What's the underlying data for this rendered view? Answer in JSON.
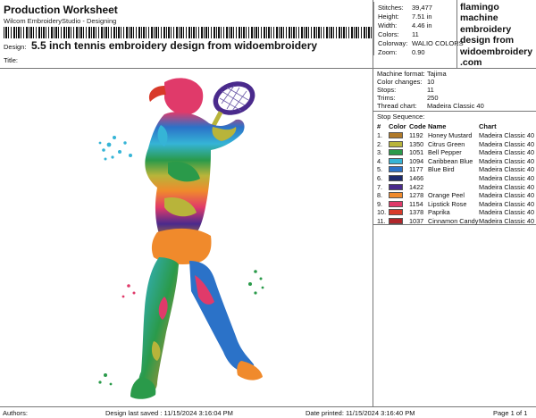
{
  "header": {
    "title": "Production Worksheet",
    "subtitle": "Wilcom EmbroideryStudio - Designing",
    "design_label": "Design:",
    "design_name": "5.5 inch tennis embroidery design from widoembroidery",
    "title_label": "Title:"
  },
  "stats": [
    {
      "label": "Stitches:",
      "value": "39,477"
    },
    {
      "label": "Height:",
      "value": "7.51 in"
    },
    {
      "label": "Width:",
      "value": "4.46 in"
    },
    {
      "label": "Colors:",
      "value": "11"
    },
    {
      "label": "Colorway:",
      "value": "WALIO COLORS"
    },
    {
      "label": "Zoom:",
      "value": "0.90"
    }
  ],
  "brand": {
    "lines": [
      "flamingo",
      "machine",
      "embroidery",
      "design from",
      "widoembroidery",
      ".com"
    ]
  },
  "machine": [
    {
      "label": "Machine format:",
      "value": "Tajima"
    },
    {
      "label": "Color changes:",
      "value": "10"
    },
    {
      "label": "Stops:",
      "value": "11"
    },
    {
      "label": "Trims:",
      "value": "250"
    },
    {
      "label": "Thread chart:",
      "value": "Madeira Classic 40"
    }
  ],
  "sequence": {
    "title": "Stop Sequence:",
    "headers": {
      "num": "#",
      "color": "Color",
      "code": "Code",
      "name": "Name",
      "chart": "Chart"
    },
    "rows": [
      {
        "num": "1.",
        "code": "1192",
        "name": "Honey Mustard",
        "chart": "Madeira Classic 40",
        "color": "#b07a2a"
      },
      {
        "num": "2.",
        "code": "1350",
        "name": "Citrus Green",
        "chart": "Madeira Classic 40",
        "color": "#b8b43a"
      },
      {
        "num": "3.",
        "code": "1051",
        "name": "Bell Pepper",
        "chart": "Madeira Classic 40",
        "color": "#2a9a4a"
      },
      {
        "num": "4.",
        "code": "1094",
        "name": "Caribbean Blue",
        "chart": "Madeira Classic 40",
        "color": "#35b4d6"
      },
      {
        "num": "5.",
        "code": "1177",
        "name": "Blue Bird",
        "chart": "Madeira Classic 40",
        "color": "#2b72c8"
      },
      {
        "num": "6.",
        "code": "1466",
        "name": "",
        "chart": "Madeira Classic 40",
        "color": "#1c2a6e"
      },
      {
        "num": "7.",
        "code": "1422",
        "name": "",
        "chart": "Madeira Classic 40",
        "color": "#4a2a8c"
      },
      {
        "num": "8.",
        "code": "1278",
        "name": "Orange Peel",
        "chart": "Madeira Classic 40",
        "color": "#f08a2c"
      },
      {
        "num": "9.",
        "code": "1154",
        "name": "Lipstick Rose",
        "chart": "Madeira Classic 40",
        "color": "#e03a6a"
      },
      {
        "num": "10.",
        "code": "1378",
        "name": "Paprika",
        "chart": "Madeira Classic 40",
        "color": "#d83a2a"
      },
      {
        "num": "11.",
        "code": "1037",
        "name": "Cinnamon Candy",
        "chart": "Madeira Classic 40",
        "color": "#b0262a"
      }
    ]
  },
  "footer": {
    "authors": "Authors:",
    "saved": "Design last saved : 11/15/2024 3:16:04 PM",
    "printed": "Date printed: 11/15/2024 3:16:40 PM",
    "page": "Page 1 of 1"
  }
}
